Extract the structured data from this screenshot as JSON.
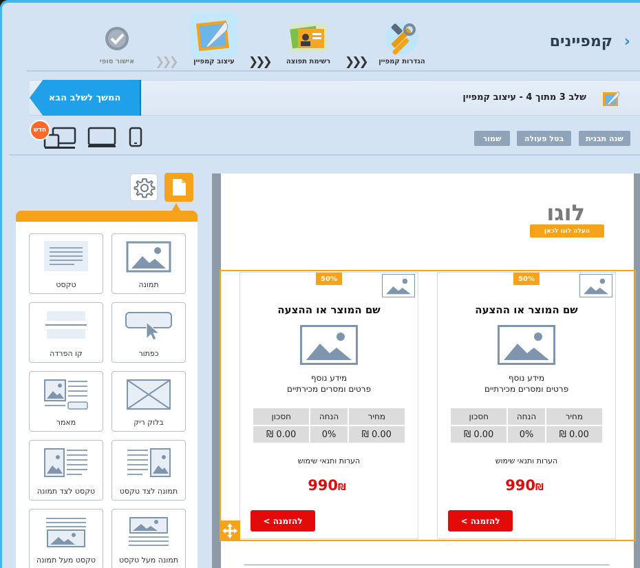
{
  "header": {
    "title": "קמפיינים",
    "back_icon": "chevron-right-icon"
  },
  "steps": [
    {
      "label": "הגדרות קמפיין",
      "icon": "tools-icon"
    },
    {
      "label": "רשימת תפוצה",
      "icon": "contact-cards-icon"
    },
    {
      "label": "עיצוב קמפיין",
      "icon": "design-quill-icon",
      "active": true
    },
    {
      "label": "אישור סופי",
      "icon": "check-circle-icon"
    }
  ],
  "step_strip": {
    "info": "שלב 3 מתוך 4 - עיצוב קמפיין",
    "next_label": "המשך לשלב הבא"
  },
  "toolbar": {
    "change_template": "שנה תבנית",
    "undo": "בטל פעולה",
    "save": "שמור",
    "new_badge": "חדש",
    "devices": [
      "mobile-icon",
      "desktop-icon",
      "multi-device-icon"
    ]
  },
  "palette": {
    "tiles": [
      {
        "label": "תמונה",
        "icon": "image-icon"
      },
      {
        "label": "טקסט",
        "icon": "text-icon"
      },
      {
        "label": "כפתור",
        "icon": "button-icon"
      },
      {
        "label": "קו הפרדה",
        "icon": "divider-icon"
      },
      {
        "label": "בלוק ריק",
        "icon": "empty-block-icon"
      },
      {
        "label": "מאמר",
        "icon": "article-icon"
      },
      {
        "label": "תמונה לצד טקסט",
        "icon": "image-beside-text-icon"
      },
      {
        "label": "טקסט לצד תמונה",
        "icon": "text-beside-image-icon"
      },
      {
        "label": "תמונה מעל טקסט",
        "icon": "image-above-text-icon"
      },
      {
        "label": "טקסט מעל תמונה",
        "icon": "text-above-image-icon"
      }
    ]
  },
  "email": {
    "logo": "לוגו",
    "logo_upload": "העלה לוגו לכאן",
    "cards": [
      {
        "pct": "50%",
        "title": "שם המוצר או ההצעה",
        "more1": "מידע נוסף",
        "more2": "פרטים ומסרים מכירתיים",
        "headers": [
          "מחיר",
          "הנחה",
          "חסכון"
        ],
        "values": [
          "0.00 ₪",
          "0%",
          "0.00 ₪"
        ],
        "terms": "הערות ותנאי שימוש",
        "price": "990",
        "currency": "₪",
        "order": "להזמנה >"
      },
      {
        "pct": "50%",
        "title": "שם המוצר או ההצעה",
        "more1": "מידע נוסף",
        "more2": "פרטים ומסרים מכירתיים",
        "headers": [
          "מחיר",
          "הנחה",
          "חסכון"
        ],
        "values": [
          "0.00 ₪",
          "0%",
          "0.00 ₪"
        ],
        "terms": "הערות ותנאי שימוש",
        "price": "990",
        "currency": "₪",
        "order": "להזמנה >"
      }
    ]
  },
  "colors": {
    "accent": "#f7a21b",
    "primary": "#1fa0e8",
    "price": "#e30a0a"
  }
}
